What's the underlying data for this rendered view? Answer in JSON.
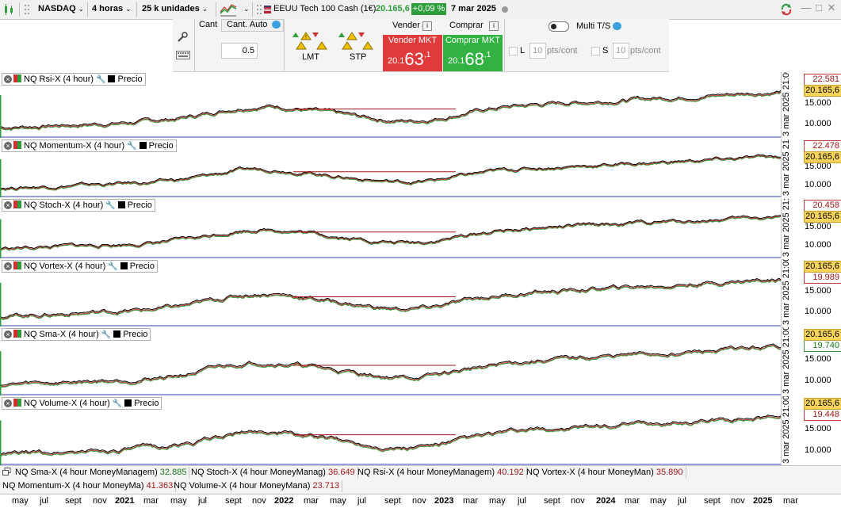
{
  "toolbar": {
    "instrument": "NASDAQ",
    "timeframe": "4 horas",
    "units": "25 k unidades",
    "symbol": "EEUU Tech 100 Cash (1€)",
    "price": "20.165,6",
    "change": "+0,09 %",
    "date": "7 mar 2025"
  },
  "order": {
    "cant_label": "Cant",
    "cant_auto_label": "Cant. Auto",
    "quantity": "0.5",
    "lmt_label": "LMT",
    "stp_label": "STP",
    "sell_label": "Vender",
    "buy_label": "Comprar",
    "sell_mkt": "Vender MKT",
    "buy_mkt": "Comprar MKT",
    "sell_small": "20.1",
    "sell_big": "63",
    "sell_sup": "1",
    "buy_small": "20.1",
    "buy_big": "68",
    "buy_sup": "1",
    "multi_ts": "Multi T/S",
    "l_label": "L",
    "s_label": "S",
    "l_value": "10",
    "s_value": "10",
    "pts_label": "pts/cont"
  },
  "panes": [
    {
      "title": "NQ Rsi-X (4 hour)",
      "price_label": "Precio",
      "ind_value": "22.581",
      "ind_tag": "red",
      "ind_above": true
    },
    {
      "title": "NQ Momentum-X (4 hour)",
      "price_label": "Precio",
      "ind_value": "22.478",
      "ind_tag": "red",
      "ind_above": true
    },
    {
      "title": "NQ Stoch-X (4 hour)",
      "price_label": "Precio",
      "ind_value": "20.458",
      "ind_tag": "red",
      "ind_above": true
    },
    {
      "title": "NQ  Vortex-X (4 hour)",
      "price_label": "Precio",
      "ind_value": "19.989",
      "ind_tag": "red",
      "ind_above": false
    },
    {
      "title": "NQ Sma-X (4 hour)",
      "price_label": "Precio",
      "ind_value": "19.740",
      "ind_tag": "green",
      "ind_above": false
    },
    {
      "title": "NQ Volume-X (4 hour)",
      "price_label": "Precio",
      "ind_value": "19.448",
      "ind_tag": "red",
      "ind_above": false
    }
  ],
  "axis": {
    "price_tag": "20.165,6",
    "ticks": [
      "15.000",
      "10.000"
    ],
    "date_label": "3 mar 2025 21:00"
  },
  "money_management": [
    {
      "label": "NQ Sma-X (4 hour MoneyManagem)",
      "value": "32.885",
      "color": "green"
    },
    {
      "label": "NQ Stoch-X (4 hour MoneyManag)",
      "value": "36.649",
      "color": "red"
    },
    {
      "label": "NQ Rsi-X (4 hour MoneyManagem)",
      "value": "40.192",
      "color": "red"
    },
    {
      "label": "NQ  Vortex-X (4 hour MoneyMan)",
      "value": "35.890",
      "color": "red"
    },
    {
      "label": "NQ Momentum-X (4 hour MoneyMa)",
      "value": "41.363",
      "color": "red"
    },
    {
      "label": "NQ Volume-X (4 hour MoneyMana)",
      "value": "23.713",
      "color": "red"
    }
  ],
  "time_axis": [
    "may",
    "jul",
    "sept",
    "nov",
    "2021",
    "mar",
    "may",
    "jul",
    "sept",
    "nov",
    "2022",
    "mar",
    "may",
    "jul",
    "sept",
    "nov",
    "2023",
    "mar",
    "may",
    "jul",
    "sept",
    "nov",
    "2024",
    "mar",
    "may",
    "jul",
    "sept",
    "nov",
    "2025",
    "mar"
  ],
  "colors": {
    "price_line": "#000000",
    "green_line": "#2e9e3c",
    "red_line": "#c02020",
    "accent_sell": "#e03a3a",
    "accent_buy": "#32b242"
  }
}
